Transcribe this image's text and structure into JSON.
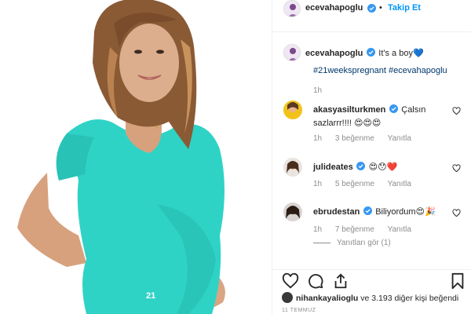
{
  "post": {
    "author": "ecevahapoglu",
    "follow_label": "Takip Et",
    "caption_text": "It's a boy",
    "caption_emoji": "💙",
    "hashtags": "#21weekspregnant #ecevahapoglu",
    "caption_time": "1h"
  },
  "comments": [
    {
      "username": "akasyasilturkmen",
      "text": "Çalsın sazlarrr!!!! 😍😍😍",
      "time": "1h",
      "likes": "3 beğenme",
      "reply": "Yanıtla",
      "verified": true
    },
    {
      "username": "julideates",
      "text": "😍😯❤️",
      "time": "1h",
      "likes": "5 beğenme",
      "reply": "Yanıtla",
      "verified": true
    },
    {
      "username": "ebrudestan",
      "text": "Biliyordum😍🎉",
      "time": "1h",
      "likes": "7 beğenme",
      "reply": "Yanıtla",
      "view_replies": "Yanıtları gör (1)",
      "verified": true
    }
  ],
  "likes_summary": {
    "user": "nihankayalioglu",
    "rest": "ve 3.193 diğer kişi beğendi"
  },
  "date_label": "11 TEMMUZ",
  "colors": {
    "accent_blue": "#0095f6",
    "verified_blue": "#3897f0",
    "hashtag": "#00376b",
    "muted": "#8e8e8e",
    "shirt": "#2fd3c6"
  }
}
